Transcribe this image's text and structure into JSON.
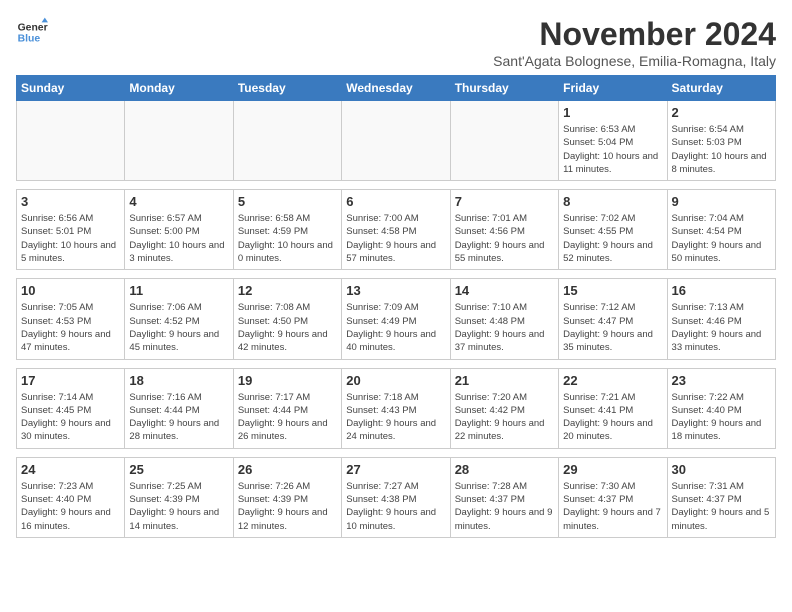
{
  "logo": {
    "line1": "General",
    "line2": "Blue"
  },
  "title": "November 2024",
  "subtitle": "Sant'Agata Bolognese, Emilia-Romagna, Italy",
  "weekdays": [
    "Sunday",
    "Monday",
    "Tuesday",
    "Wednesday",
    "Thursday",
    "Friday",
    "Saturday"
  ],
  "weeks": [
    [
      {
        "day": "",
        "info": ""
      },
      {
        "day": "",
        "info": ""
      },
      {
        "day": "",
        "info": ""
      },
      {
        "day": "",
        "info": ""
      },
      {
        "day": "",
        "info": ""
      },
      {
        "day": "1",
        "info": "Sunrise: 6:53 AM\nSunset: 5:04 PM\nDaylight: 10 hours and 11 minutes."
      },
      {
        "day": "2",
        "info": "Sunrise: 6:54 AM\nSunset: 5:03 PM\nDaylight: 10 hours and 8 minutes."
      }
    ],
    [
      {
        "day": "3",
        "info": "Sunrise: 6:56 AM\nSunset: 5:01 PM\nDaylight: 10 hours and 5 minutes."
      },
      {
        "day": "4",
        "info": "Sunrise: 6:57 AM\nSunset: 5:00 PM\nDaylight: 10 hours and 3 minutes."
      },
      {
        "day": "5",
        "info": "Sunrise: 6:58 AM\nSunset: 4:59 PM\nDaylight: 10 hours and 0 minutes."
      },
      {
        "day": "6",
        "info": "Sunrise: 7:00 AM\nSunset: 4:58 PM\nDaylight: 9 hours and 57 minutes."
      },
      {
        "day": "7",
        "info": "Sunrise: 7:01 AM\nSunset: 4:56 PM\nDaylight: 9 hours and 55 minutes."
      },
      {
        "day": "8",
        "info": "Sunrise: 7:02 AM\nSunset: 4:55 PM\nDaylight: 9 hours and 52 minutes."
      },
      {
        "day": "9",
        "info": "Sunrise: 7:04 AM\nSunset: 4:54 PM\nDaylight: 9 hours and 50 minutes."
      }
    ],
    [
      {
        "day": "10",
        "info": "Sunrise: 7:05 AM\nSunset: 4:53 PM\nDaylight: 9 hours and 47 minutes."
      },
      {
        "day": "11",
        "info": "Sunrise: 7:06 AM\nSunset: 4:52 PM\nDaylight: 9 hours and 45 minutes."
      },
      {
        "day": "12",
        "info": "Sunrise: 7:08 AM\nSunset: 4:50 PM\nDaylight: 9 hours and 42 minutes."
      },
      {
        "day": "13",
        "info": "Sunrise: 7:09 AM\nSunset: 4:49 PM\nDaylight: 9 hours and 40 minutes."
      },
      {
        "day": "14",
        "info": "Sunrise: 7:10 AM\nSunset: 4:48 PM\nDaylight: 9 hours and 37 minutes."
      },
      {
        "day": "15",
        "info": "Sunrise: 7:12 AM\nSunset: 4:47 PM\nDaylight: 9 hours and 35 minutes."
      },
      {
        "day": "16",
        "info": "Sunrise: 7:13 AM\nSunset: 4:46 PM\nDaylight: 9 hours and 33 minutes."
      }
    ],
    [
      {
        "day": "17",
        "info": "Sunrise: 7:14 AM\nSunset: 4:45 PM\nDaylight: 9 hours and 30 minutes."
      },
      {
        "day": "18",
        "info": "Sunrise: 7:16 AM\nSunset: 4:44 PM\nDaylight: 9 hours and 28 minutes."
      },
      {
        "day": "19",
        "info": "Sunrise: 7:17 AM\nSunset: 4:44 PM\nDaylight: 9 hours and 26 minutes."
      },
      {
        "day": "20",
        "info": "Sunrise: 7:18 AM\nSunset: 4:43 PM\nDaylight: 9 hours and 24 minutes."
      },
      {
        "day": "21",
        "info": "Sunrise: 7:20 AM\nSunset: 4:42 PM\nDaylight: 9 hours and 22 minutes."
      },
      {
        "day": "22",
        "info": "Sunrise: 7:21 AM\nSunset: 4:41 PM\nDaylight: 9 hours and 20 minutes."
      },
      {
        "day": "23",
        "info": "Sunrise: 7:22 AM\nSunset: 4:40 PM\nDaylight: 9 hours and 18 minutes."
      }
    ],
    [
      {
        "day": "24",
        "info": "Sunrise: 7:23 AM\nSunset: 4:40 PM\nDaylight: 9 hours and 16 minutes."
      },
      {
        "day": "25",
        "info": "Sunrise: 7:25 AM\nSunset: 4:39 PM\nDaylight: 9 hours and 14 minutes."
      },
      {
        "day": "26",
        "info": "Sunrise: 7:26 AM\nSunset: 4:39 PM\nDaylight: 9 hours and 12 minutes."
      },
      {
        "day": "27",
        "info": "Sunrise: 7:27 AM\nSunset: 4:38 PM\nDaylight: 9 hours and 10 minutes."
      },
      {
        "day": "28",
        "info": "Sunrise: 7:28 AM\nSunset: 4:37 PM\nDaylight: 9 hours and 9 minutes."
      },
      {
        "day": "29",
        "info": "Sunrise: 7:30 AM\nSunset: 4:37 PM\nDaylight: 9 hours and 7 minutes."
      },
      {
        "day": "30",
        "info": "Sunrise: 7:31 AM\nSunset: 4:37 PM\nDaylight: 9 hours and 5 minutes."
      }
    ]
  ]
}
